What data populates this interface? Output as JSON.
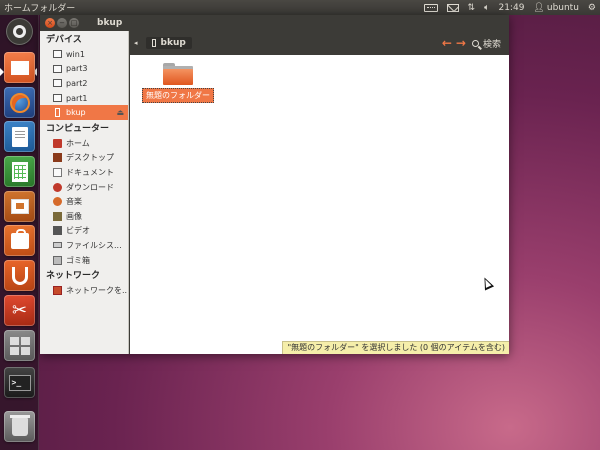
{
  "top_panel": {
    "title": "ホームフォルダー",
    "clock": "21:49",
    "user": "ubuntu",
    "icons": [
      "keyboard-icon",
      "mail-icon",
      "network-icon",
      "volume-icon",
      "gear-icon"
    ]
  },
  "launcher": {
    "items": [
      {
        "name": "dash-home",
        "icon": "ubuntu-logo-icon"
      },
      {
        "name": "home-folder",
        "icon": "folder-home-icon",
        "active": true
      },
      {
        "name": "firefox",
        "icon": "firefox-icon"
      },
      {
        "name": "libreoffice-writer",
        "icon": "writer-icon"
      },
      {
        "name": "libreoffice-calc",
        "icon": "calc-icon"
      },
      {
        "name": "libreoffice-impress",
        "icon": "impress-icon"
      },
      {
        "name": "software-center",
        "icon": "software-center-icon"
      },
      {
        "name": "ubuntu-one",
        "icon": "ubuntu-one-icon"
      },
      {
        "name": "system-settings",
        "icon": "settings-icon"
      },
      {
        "name": "workspace-switcher",
        "icon": "workspace-icon"
      },
      {
        "name": "terminal",
        "icon": "terminal-icon",
        "glyph": ">_"
      },
      {
        "name": "trash",
        "icon": "trash-icon"
      }
    ]
  },
  "window": {
    "title": "bkup",
    "close_glyph": "×",
    "min_glyph": "−",
    "max_glyph": "□"
  },
  "sidebar": {
    "devices_header": "デバイス",
    "devices": [
      {
        "label": "win1",
        "icon": "drive-icon"
      },
      {
        "label": "part3",
        "icon": "drive-icon"
      },
      {
        "label": "part2",
        "icon": "drive-icon"
      },
      {
        "label": "part1",
        "icon": "drive-icon"
      },
      {
        "label": "bkup",
        "icon": "usb-drive-icon",
        "selected": true
      }
    ],
    "eject_glyph": "⏏",
    "computer_header": "コンピューター",
    "computer": [
      {
        "label": "ホーム",
        "icon": "home-icon"
      },
      {
        "label": "デスクトップ",
        "icon": "desktop-icon"
      },
      {
        "label": "ドキュメント",
        "icon": "documents-icon"
      },
      {
        "label": "ダウンロード",
        "icon": "downloads-icon"
      },
      {
        "label": "音楽",
        "icon": "music-icon"
      },
      {
        "label": "画像",
        "icon": "pictures-icon"
      },
      {
        "label": "ビデオ",
        "icon": "videos-icon"
      },
      {
        "label": "ファイルシス...",
        "icon": "filesystem-icon"
      },
      {
        "label": "ゴミ箱",
        "icon": "trash-icon"
      }
    ],
    "network_header": "ネットワーク",
    "network": [
      {
        "label": "ネットワークを...",
        "icon": "network-icon"
      }
    ]
  },
  "pathbar": {
    "left_glyph": "◂",
    "crumb": "bkup",
    "back_glyph": "←",
    "forward_glyph": "→",
    "search_label": "検索"
  },
  "content": {
    "folder_label": "無題のフォルダー",
    "status": "\"無題のフォルダー\" を選択しました (0 個のアイテムを含む)"
  },
  "colors": {
    "accent": "#f07746",
    "panel": "#3c3b37",
    "status_bg": "#f5eeaa"
  }
}
